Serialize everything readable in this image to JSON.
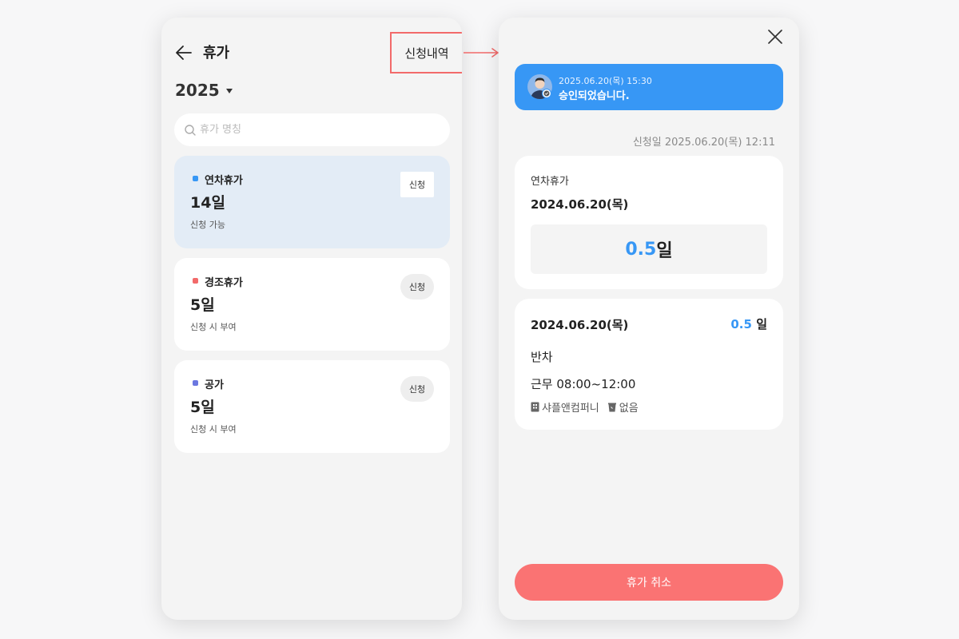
{
  "left_screen": {
    "title": "휴가",
    "history_button": "신청내역",
    "year": "2025",
    "search": {
      "placeholder": "휴가 명칭"
    },
    "leave_items": [
      {
        "name": "연차휴가",
        "days": "14일",
        "sub": "신청 가능",
        "apply_label": "신청",
        "color": "#3797f5"
      },
      {
        "name": "경조휴가",
        "days": "5일",
        "sub": "신청 시 부여",
        "apply_label": "신청",
        "color": "#f26a6a"
      },
      {
        "name": "공가",
        "days": "5일",
        "sub": "신청 시 부여",
        "apply_label": "신청",
        "color": "#6b77e0"
      }
    ]
  },
  "right_screen": {
    "banner": {
      "timestamp": "2025.06.20(목) 15:30",
      "message": "승인되었습니다.",
      "color": "#3797f5"
    },
    "apply_date": "신청일 2025.06.20(목) 12:11",
    "summary": {
      "type": "연차휴가",
      "date": "2024.06.20(목)",
      "days_value": "0.5",
      "days_unit": "일"
    },
    "detail": {
      "date": "2024.06.20(목)",
      "days_value": "0.5",
      "days_unit": "일",
      "type": "반차",
      "hours": "근무 08:00~12:00",
      "company": "샤플앤컴퍼니",
      "break": "없음"
    },
    "cancel_button": "휴가 취소",
    "cancel_color": "#fa7373"
  }
}
